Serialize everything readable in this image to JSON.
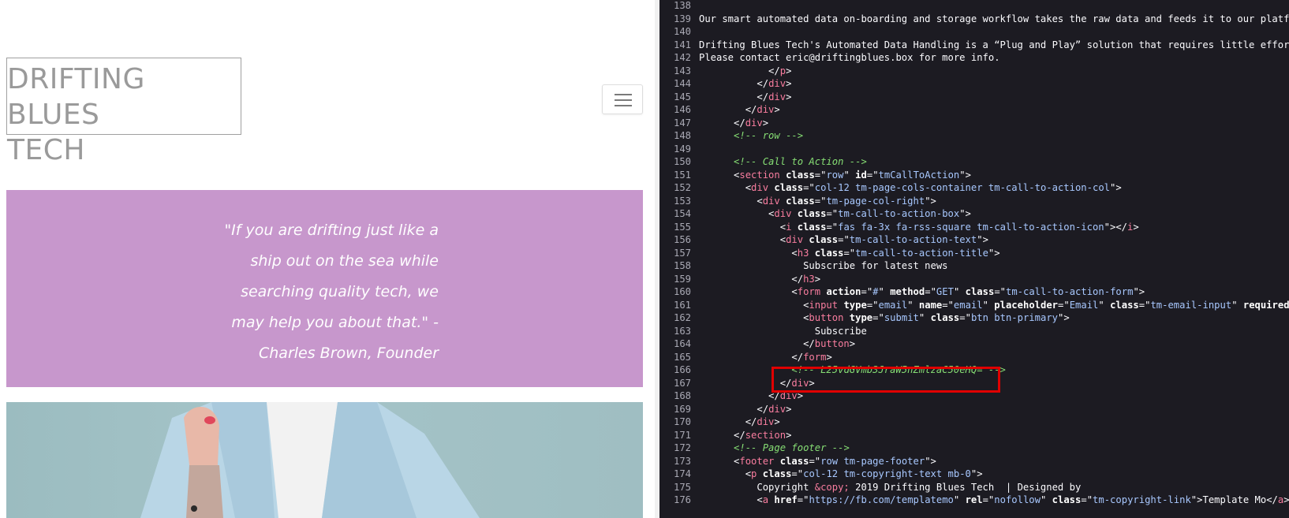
{
  "site": {
    "logo_text": "DRIFTING BLUES\nTECH",
    "quote": "\"If you are drifting just like a ship out on the sea while searching quality tech, we may help you about that.\" -Charles Brown, Founder",
    "menu_icon": "hamburger-icon",
    "colors": {
      "quote_bg": "#c797cc",
      "logo": "#9a9a9a"
    }
  },
  "source": {
    "colors": {
      "background": "#1c1b22",
      "tag": "#f97d9f",
      "value": "#a8c8ff",
      "comment": "#86de74",
      "highlight": "#e00000"
    },
    "lines": [
      {
        "n": "138",
        "segs": []
      },
      {
        "n": "139",
        "segs": [
          {
            "c": "txt",
            "t": "Our smart automated data on-boarding and storage workflow takes the raw data and feeds it to our platform"
          }
        ]
      },
      {
        "n": "140",
        "segs": []
      },
      {
        "n": "141",
        "segs": [
          {
            "c": "txt",
            "t": "Drifting Blues Tech's Automated Data Handling is a “Plug and Play” solution that requires little efforts a"
          }
        ]
      },
      {
        "n": "142",
        "segs": [
          {
            "c": "txt",
            "t": "Please contact eric@driftingblues.box for more info."
          }
        ]
      },
      {
        "n": "143",
        "segs": [
          {
            "c": "txt",
            "t": "            </"
          },
          {
            "c": "tag",
            "t": "p"
          },
          {
            "c": "txt",
            "t": ">"
          }
        ]
      },
      {
        "n": "144",
        "segs": [
          {
            "c": "txt",
            "t": "          </"
          },
          {
            "c": "tag",
            "t": "div"
          },
          {
            "c": "txt",
            "t": ">"
          }
        ]
      },
      {
        "n": "145",
        "segs": [
          {
            "c": "txt",
            "t": "          </"
          },
          {
            "c": "tag",
            "t": "div"
          },
          {
            "c": "txt",
            "t": ">"
          }
        ]
      },
      {
        "n": "146",
        "segs": [
          {
            "c": "txt",
            "t": "        </"
          },
          {
            "c": "tag",
            "t": "div"
          },
          {
            "c": "txt",
            "t": ">"
          }
        ]
      },
      {
        "n": "147",
        "segs": [
          {
            "c": "txt",
            "t": "      </"
          },
          {
            "c": "tag",
            "t": "div"
          },
          {
            "c": "txt",
            "t": ">"
          }
        ]
      },
      {
        "n": "148",
        "segs": [
          {
            "c": "txt",
            "t": "      "
          },
          {
            "c": "cmt",
            "t": "<!-- row -->"
          }
        ]
      },
      {
        "n": "149",
        "segs": []
      },
      {
        "n": "150",
        "segs": [
          {
            "c": "txt",
            "t": "      "
          },
          {
            "c": "cmt",
            "t": "<!-- Call to Action -->"
          }
        ]
      },
      {
        "n": "151",
        "segs": [
          {
            "c": "txt",
            "t": "      <"
          },
          {
            "c": "tag",
            "t": "section"
          },
          {
            "c": "txt",
            "t": " "
          },
          {
            "c": "attr",
            "t": "class"
          },
          {
            "c": "txt",
            "t": "=\""
          },
          {
            "c": "val",
            "t": "row"
          },
          {
            "c": "txt",
            "t": "\" "
          },
          {
            "c": "attr",
            "t": "id"
          },
          {
            "c": "txt",
            "t": "=\""
          },
          {
            "c": "val",
            "t": "tmCallToAction"
          },
          {
            "c": "txt",
            "t": "\">"
          }
        ]
      },
      {
        "n": "152",
        "segs": [
          {
            "c": "txt",
            "t": "        <"
          },
          {
            "c": "tag",
            "t": "div"
          },
          {
            "c": "txt",
            "t": " "
          },
          {
            "c": "attr",
            "t": "class"
          },
          {
            "c": "txt",
            "t": "=\""
          },
          {
            "c": "val",
            "t": "col-12 tm-page-cols-container tm-call-to-action-col"
          },
          {
            "c": "txt",
            "t": "\">"
          }
        ]
      },
      {
        "n": "153",
        "segs": [
          {
            "c": "txt",
            "t": "          <"
          },
          {
            "c": "tag",
            "t": "div"
          },
          {
            "c": "txt",
            "t": " "
          },
          {
            "c": "attr",
            "t": "class"
          },
          {
            "c": "txt",
            "t": "=\""
          },
          {
            "c": "val",
            "t": "tm-page-col-right"
          },
          {
            "c": "txt",
            "t": "\">"
          }
        ]
      },
      {
        "n": "154",
        "segs": [
          {
            "c": "txt",
            "t": "            <"
          },
          {
            "c": "tag",
            "t": "div"
          },
          {
            "c": "txt",
            "t": " "
          },
          {
            "c": "attr",
            "t": "class"
          },
          {
            "c": "txt",
            "t": "=\""
          },
          {
            "c": "val",
            "t": "tm-call-to-action-box"
          },
          {
            "c": "txt",
            "t": "\">"
          }
        ]
      },
      {
        "n": "155",
        "segs": [
          {
            "c": "txt",
            "t": "              <"
          },
          {
            "c": "tag",
            "t": "i"
          },
          {
            "c": "txt",
            "t": " "
          },
          {
            "c": "attr",
            "t": "class"
          },
          {
            "c": "txt",
            "t": "=\""
          },
          {
            "c": "val",
            "t": "fas fa-3x fa-rss-square tm-call-to-action-icon"
          },
          {
            "c": "txt",
            "t": "\"></"
          },
          {
            "c": "tag",
            "t": "i"
          },
          {
            "c": "txt",
            "t": ">"
          }
        ]
      },
      {
        "n": "156",
        "segs": [
          {
            "c": "txt",
            "t": "              <"
          },
          {
            "c": "tag",
            "t": "div"
          },
          {
            "c": "txt",
            "t": " "
          },
          {
            "c": "attr",
            "t": "class"
          },
          {
            "c": "txt",
            "t": "=\""
          },
          {
            "c": "val",
            "t": "tm-call-to-action-text"
          },
          {
            "c": "txt",
            "t": "\">"
          }
        ]
      },
      {
        "n": "157",
        "segs": [
          {
            "c": "txt",
            "t": "                <"
          },
          {
            "c": "tag",
            "t": "h3"
          },
          {
            "c": "txt",
            "t": " "
          },
          {
            "c": "attr",
            "t": "class"
          },
          {
            "c": "txt",
            "t": "=\""
          },
          {
            "c": "val",
            "t": "tm-call-to-action-title"
          },
          {
            "c": "txt",
            "t": "\">"
          }
        ]
      },
      {
        "n": "158",
        "segs": [
          {
            "c": "txt",
            "t": "                  Subscribe for latest news"
          }
        ]
      },
      {
        "n": "159",
        "segs": [
          {
            "c": "txt",
            "t": "                </"
          },
          {
            "c": "tag",
            "t": "h3"
          },
          {
            "c": "txt",
            "t": ">"
          }
        ]
      },
      {
        "n": "160",
        "segs": [
          {
            "c": "txt",
            "t": "                <"
          },
          {
            "c": "tag",
            "t": "form"
          },
          {
            "c": "txt",
            "t": " "
          },
          {
            "c": "attr",
            "t": "action"
          },
          {
            "c": "txt",
            "t": "=\""
          },
          {
            "c": "val",
            "t": "#"
          },
          {
            "c": "txt",
            "t": "\" "
          },
          {
            "c": "attr",
            "t": "method"
          },
          {
            "c": "txt",
            "t": "=\""
          },
          {
            "c": "val",
            "t": "GET"
          },
          {
            "c": "txt",
            "t": "\" "
          },
          {
            "c": "attr",
            "t": "class"
          },
          {
            "c": "txt",
            "t": "=\""
          },
          {
            "c": "val",
            "t": "tm-call-to-action-form"
          },
          {
            "c": "txt",
            "t": "\">"
          }
        ]
      },
      {
        "n": "161",
        "segs": [
          {
            "c": "txt",
            "t": "                  <"
          },
          {
            "c": "tag",
            "t": "input"
          },
          {
            "c": "txt",
            "t": " "
          },
          {
            "c": "attr",
            "t": "type"
          },
          {
            "c": "txt",
            "t": "=\""
          },
          {
            "c": "val",
            "t": "email"
          },
          {
            "c": "txt",
            "t": "\" "
          },
          {
            "c": "attr",
            "t": "name"
          },
          {
            "c": "txt",
            "t": "=\""
          },
          {
            "c": "val",
            "t": "email"
          },
          {
            "c": "txt",
            "t": "\" "
          },
          {
            "c": "attr",
            "t": "placeholder"
          },
          {
            "c": "txt",
            "t": "=\""
          },
          {
            "c": "val",
            "t": "Email"
          },
          {
            "c": "txt",
            "t": "\" "
          },
          {
            "c": "attr",
            "t": "class"
          },
          {
            "c": "txt",
            "t": "=\""
          },
          {
            "c": "val",
            "t": "tm-email-input"
          },
          {
            "c": "txt",
            "t": "\" "
          },
          {
            "c": "attr",
            "t": "required"
          },
          {
            "c": "txt",
            "t": " />"
          }
        ]
      },
      {
        "n": "162",
        "segs": [
          {
            "c": "txt",
            "t": "                  <"
          },
          {
            "c": "tag",
            "t": "button"
          },
          {
            "c": "txt",
            "t": " "
          },
          {
            "c": "attr",
            "t": "type"
          },
          {
            "c": "txt",
            "t": "=\""
          },
          {
            "c": "val",
            "t": "submit"
          },
          {
            "c": "txt",
            "t": "\" "
          },
          {
            "c": "attr",
            "t": "class"
          },
          {
            "c": "txt",
            "t": "=\""
          },
          {
            "c": "val",
            "t": "btn btn-primary"
          },
          {
            "c": "txt",
            "t": "\">"
          }
        ]
      },
      {
        "n": "163",
        "segs": [
          {
            "c": "txt",
            "t": "                    Subscribe"
          }
        ]
      },
      {
        "n": "164",
        "segs": [
          {
            "c": "txt",
            "t": "                  </"
          },
          {
            "c": "tag",
            "t": "button"
          },
          {
            "c": "txt",
            "t": ">"
          }
        ]
      },
      {
        "n": "165",
        "segs": [
          {
            "c": "txt",
            "t": "                </"
          },
          {
            "c": "tag",
            "t": "form"
          },
          {
            "c": "txt",
            "t": ">"
          }
        ]
      },
      {
        "n": "166",
        "segs": [
          {
            "c": "txt",
            "t": "                "
          },
          {
            "c": "cmt",
            "t": "<!-- L25vdGVmb3JraW5nZmlzaC50eHQ= -->"
          }
        ]
      },
      {
        "n": "167",
        "segs": [
          {
            "c": "txt",
            "t": "              </"
          },
          {
            "c": "tag",
            "t": "div"
          },
          {
            "c": "txt",
            "t": ">"
          }
        ]
      },
      {
        "n": "168",
        "segs": [
          {
            "c": "txt",
            "t": "            </"
          },
          {
            "c": "tag",
            "t": "div"
          },
          {
            "c": "txt",
            "t": ">"
          }
        ]
      },
      {
        "n": "169",
        "segs": [
          {
            "c": "txt",
            "t": "          </"
          },
          {
            "c": "tag",
            "t": "div"
          },
          {
            "c": "txt",
            "t": ">"
          }
        ]
      },
      {
        "n": "170",
        "segs": [
          {
            "c": "txt",
            "t": "        </"
          },
          {
            "c": "tag",
            "t": "div"
          },
          {
            "c": "txt",
            "t": ">"
          }
        ]
      },
      {
        "n": "171",
        "segs": [
          {
            "c": "txt",
            "t": "      </"
          },
          {
            "c": "tag",
            "t": "section"
          },
          {
            "c": "txt",
            "t": ">"
          }
        ]
      },
      {
        "n": "172",
        "segs": [
          {
            "c": "txt",
            "t": "      "
          },
          {
            "c": "cmt",
            "t": "<!-- Page footer -->"
          }
        ]
      },
      {
        "n": "173",
        "segs": [
          {
            "c": "txt",
            "t": "      <"
          },
          {
            "c": "tag",
            "t": "footer"
          },
          {
            "c": "txt",
            "t": " "
          },
          {
            "c": "attr",
            "t": "class"
          },
          {
            "c": "txt",
            "t": "=\""
          },
          {
            "c": "val",
            "t": "row tm-page-footer"
          },
          {
            "c": "txt",
            "t": "\">"
          }
        ]
      },
      {
        "n": "174",
        "segs": [
          {
            "c": "txt",
            "t": "        <"
          },
          {
            "c": "tag",
            "t": "p"
          },
          {
            "c": "txt",
            "t": " "
          },
          {
            "c": "attr",
            "t": "class"
          },
          {
            "c": "txt",
            "t": "=\""
          },
          {
            "c": "val",
            "t": "col-12 tm-copyright-text mb-0"
          },
          {
            "c": "txt",
            "t": "\">"
          }
        ]
      },
      {
        "n": "175",
        "segs": [
          {
            "c": "txt",
            "t": "          Copyright "
          },
          {
            "c": "tag",
            "t": "&copy;"
          },
          {
            "c": "txt",
            "t": " 2019 Drifting Blues Tech  | Designed by"
          }
        ]
      },
      {
        "n": "176",
        "segs": [
          {
            "c": "txt",
            "t": "          <"
          },
          {
            "c": "tag",
            "t": "a"
          },
          {
            "c": "txt",
            "t": " "
          },
          {
            "c": "attr",
            "t": "href"
          },
          {
            "c": "txt",
            "t": "=\""
          },
          {
            "c": "val",
            "t": "https://fb.com/templatemo"
          },
          {
            "c": "txt",
            "t": "\" "
          },
          {
            "c": "attr",
            "t": "rel"
          },
          {
            "c": "txt",
            "t": "=\""
          },
          {
            "c": "val",
            "t": "nofollow"
          },
          {
            "c": "txt",
            "t": "\" "
          },
          {
            "c": "attr",
            "t": "class"
          },
          {
            "c": "txt",
            "t": "=\""
          },
          {
            "c": "val",
            "t": "tm-copyright-link"
          },
          {
            "c": "txt",
            "t": "\">"
          },
          {
            "c": "txt",
            "t": "Template Mo"
          },
          {
            "c": "txt",
            "t": "</"
          },
          {
            "c": "tag",
            "t": "a"
          },
          {
            "c": "txt",
            "t": ">"
          }
        ]
      }
    ]
  }
}
